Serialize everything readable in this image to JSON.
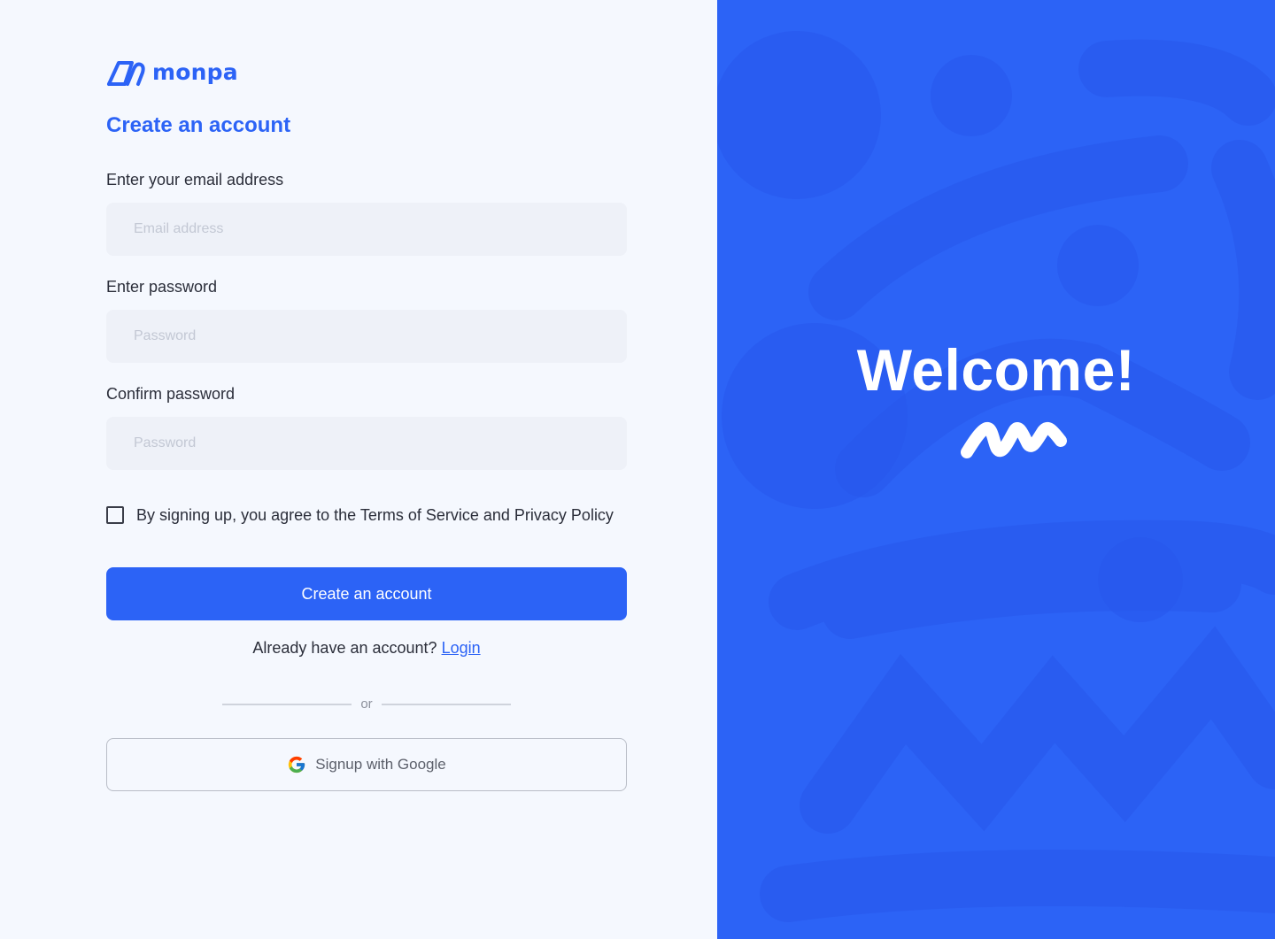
{
  "brand": {
    "name": "monpa",
    "color": "#2c63f6"
  },
  "form": {
    "title": "Create an account",
    "email": {
      "label": "Enter your email address",
      "placeholder": "Email address",
      "value": ""
    },
    "password": {
      "label": "Enter password",
      "placeholder": "Password",
      "value": ""
    },
    "confirm_password": {
      "label": "Confirm password",
      "placeholder": "Password",
      "value": ""
    },
    "terms": {
      "text": "By signing up, you agree to the Terms of Service and Privacy Policy",
      "checked": false
    },
    "submit_label": "Create an account",
    "login_prompt": "Already have an account?",
    "login_link": "Login",
    "divider_text": "or",
    "google_label": "Signup with Google",
    "google_icon": "google-icon"
  },
  "hero": {
    "heading": "Welcome!",
    "mark_icon": "wave-logo-icon",
    "background_color": "#2c63f6"
  }
}
